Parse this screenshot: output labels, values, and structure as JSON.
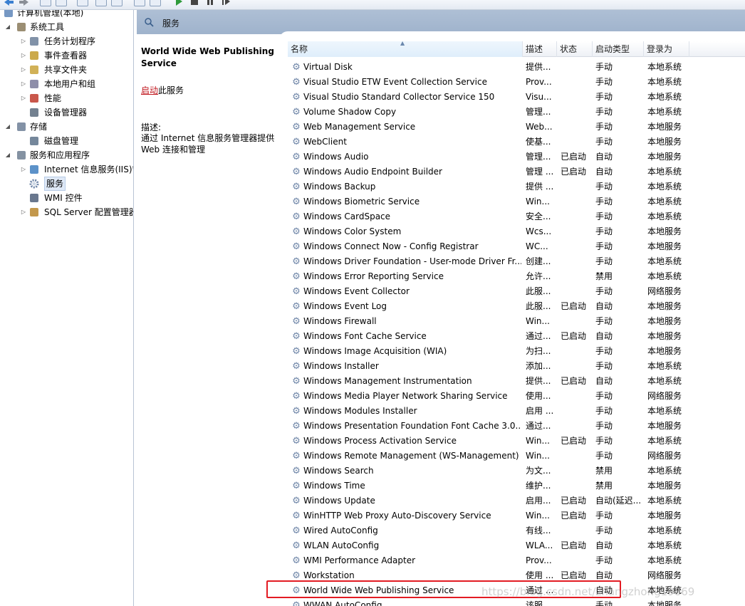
{
  "toolbar": {
    "icons": [
      "back-arrow-icon",
      "forward-arrow-icon",
      "up-folder-icon",
      "console-tree-icon",
      "properties-icon",
      "refresh-icon",
      "export-icon",
      "help-icon",
      "view-icon",
      "play-icon",
      "stop-icon",
      "pause-icon",
      "restart-icon"
    ]
  },
  "tree": {
    "items": [
      {
        "label": "计算机管理(本地)",
        "icon": "computer-icon",
        "expander": ""
      },
      {
        "label": "系统工具",
        "icon": "tools-icon",
        "expander": "◢"
      },
      {
        "label": "任务计划程序",
        "icon": "clock-icon",
        "expander": "▷"
      },
      {
        "label": "事件查看器",
        "icon": "event-viewer-icon",
        "expander": "▷"
      },
      {
        "label": "共享文件夹",
        "icon": "shared-folder-icon",
        "expander": "▷"
      },
      {
        "label": "本地用户和组",
        "icon": "users-icon",
        "expander": "▷"
      },
      {
        "label": "性能",
        "icon": "performance-icon",
        "expander": "▷"
      },
      {
        "label": "设备管理器",
        "icon": "device-manager-icon",
        "expander": ""
      },
      {
        "label": "存储",
        "icon": "storage-icon",
        "expander": "◢"
      },
      {
        "label": "磁盘管理",
        "icon": "disk-icon",
        "expander": ""
      },
      {
        "label": "服务和应用程序",
        "icon": "services-apps-icon",
        "expander": "◢"
      },
      {
        "label": "Internet 信息服务(IIS)管",
        "icon": "iis-icon",
        "expander": "▷"
      },
      {
        "label": "服务",
        "icon": "gear-icon",
        "expander": ""
      },
      {
        "label": "WMI 控件",
        "icon": "wmi-icon",
        "expander": ""
      },
      {
        "label": "SQL Server 配置管理器",
        "icon": "sql-server-icon",
        "expander": "▷"
      }
    ]
  },
  "header": {
    "title": "服务"
  },
  "detail": {
    "service_name": "World Wide Web Publishing Service",
    "action_link": "启动",
    "action_suffix": "此服务",
    "description_label": "描述:",
    "description": "通过 Internet 信息服务管理器提供 Web 连接和管理"
  },
  "columns": {
    "name": "名称",
    "desc": "描述",
    "status": "状态",
    "startup": "启动类型",
    "logon": "登录为"
  },
  "services": [
    {
      "name": "Virtual Disk",
      "desc": "提供...",
      "status": "",
      "startup": "手动",
      "logon": "本地系统"
    },
    {
      "name": "Visual Studio ETW Event Collection Service",
      "desc": "Prov...",
      "status": "",
      "startup": "手动",
      "logon": "本地系统"
    },
    {
      "name": "Visual Studio Standard Collector Service 150",
      "desc": "Visu...",
      "status": "",
      "startup": "手动",
      "logon": "本地系统"
    },
    {
      "name": "Volume Shadow Copy",
      "desc": "管理...",
      "status": "",
      "startup": "手动",
      "logon": "本地系统"
    },
    {
      "name": "Web Management Service",
      "desc": "Web...",
      "status": "",
      "startup": "手动",
      "logon": "本地服务"
    },
    {
      "name": "WebClient",
      "desc": "使基...",
      "status": "",
      "startup": "手动",
      "logon": "本地服务"
    },
    {
      "name": "Windows Audio",
      "desc": "管理...",
      "status": "已启动",
      "startup": "自动",
      "logon": "本地服务"
    },
    {
      "name": "Windows Audio Endpoint Builder",
      "desc": "管理 ...",
      "status": "已启动",
      "startup": "自动",
      "logon": "本地系统"
    },
    {
      "name": "Windows Backup",
      "desc": "提供 ...",
      "status": "",
      "startup": "手动",
      "logon": "本地系统"
    },
    {
      "name": "Windows Biometric Service",
      "desc": "Win...",
      "status": "",
      "startup": "手动",
      "logon": "本地系统"
    },
    {
      "name": "Windows CardSpace",
      "desc": "安全...",
      "status": "",
      "startup": "手动",
      "logon": "本地系统"
    },
    {
      "name": "Windows Color System",
      "desc": "Wcs...",
      "status": "",
      "startup": "手动",
      "logon": "本地服务"
    },
    {
      "name": "Windows Connect Now - Config Registrar",
      "desc": "WC...",
      "status": "",
      "startup": "手动",
      "logon": "本地服务"
    },
    {
      "name": "Windows Driver Foundation - User-mode Driver Fr...",
      "desc": "创建...",
      "status": "",
      "startup": "手动",
      "logon": "本地系统"
    },
    {
      "name": "Windows Error Reporting Service",
      "desc": "允许...",
      "status": "",
      "startup": "禁用",
      "logon": "本地系统"
    },
    {
      "name": "Windows Event Collector",
      "desc": "此服...",
      "status": "",
      "startup": "手动",
      "logon": "网络服务"
    },
    {
      "name": "Windows Event Log",
      "desc": "此服...",
      "status": "已启动",
      "startup": "自动",
      "logon": "本地服务"
    },
    {
      "name": "Windows Firewall",
      "desc": "Win...",
      "status": "",
      "startup": "手动",
      "logon": "本地服务"
    },
    {
      "name": "Windows Font Cache Service",
      "desc": "通过...",
      "status": "已启动",
      "startup": "自动",
      "logon": "本地服务"
    },
    {
      "name": "Windows Image Acquisition (WIA)",
      "desc": "为扫...",
      "status": "",
      "startup": "手动",
      "logon": "本地服务"
    },
    {
      "name": "Windows Installer",
      "desc": "添加...",
      "status": "",
      "startup": "手动",
      "logon": "本地系统"
    },
    {
      "name": "Windows Management Instrumentation",
      "desc": "提供...",
      "status": "已启动",
      "startup": "自动",
      "logon": "本地系统"
    },
    {
      "name": "Windows Media Player Network Sharing Service",
      "desc": "使用...",
      "status": "",
      "startup": "手动",
      "logon": "网络服务"
    },
    {
      "name": "Windows Modules Installer",
      "desc": "启用 ...",
      "status": "",
      "startup": "手动",
      "logon": "本地系统"
    },
    {
      "name": "Windows Presentation Foundation Font Cache 3.0....",
      "desc": "通过...",
      "status": "",
      "startup": "手动",
      "logon": "本地服务"
    },
    {
      "name": "Windows Process Activation Service",
      "desc": "Win...",
      "status": "已启动",
      "startup": "手动",
      "logon": "本地系统"
    },
    {
      "name": "Windows Remote Management (WS-Management)",
      "desc": "Win...",
      "status": "",
      "startup": "手动",
      "logon": "网络服务"
    },
    {
      "name": "Windows Search",
      "desc": "为文...",
      "status": "",
      "startup": "禁用",
      "logon": "本地系统"
    },
    {
      "name": "Windows Time",
      "desc": "维护...",
      "status": "",
      "startup": "禁用",
      "logon": "本地服务"
    },
    {
      "name": "Windows Update",
      "desc": "启用...",
      "status": "已启动",
      "startup": "自动(延迟...",
      "logon": "本地系统"
    },
    {
      "name": "WinHTTP Web Proxy Auto-Discovery Service",
      "desc": "Win...",
      "status": "已启动",
      "startup": "手动",
      "logon": "本地服务"
    },
    {
      "name": "Wired AutoConfig",
      "desc": "有线...",
      "status": "",
      "startup": "手动",
      "logon": "本地系统"
    },
    {
      "name": "WLAN AutoConfig",
      "desc": "WLA...",
      "status": "已启动",
      "startup": "自动",
      "logon": "本地系统"
    },
    {
      "name": "WMI Performance Adapter",
      "desc": "Prov...",
      "status": "",
      "startup": "手动",
      "logon": "本地系统"
    },
    {
      "name": "Workstation",
      "desc": "使用 ...",
      "status": "已启动",
      "startup": "自动",
      "logon": "网络服务"
    },
    {
      "name": "World Wide Web Publishing Service",
      "desc": "通过 ...",
      "status": "",
      "startup": "自动",
      "logon": "本地系统"
    },
    {
      "name": "WWAN AutoConfig",
      "desc": "该服...",
      "status": "",
      "startup": "手动",
      "logon": "本地服务"
    }
  ],
  "watermark": "https://blog.csdn.net/zhangzhong19869"
}
